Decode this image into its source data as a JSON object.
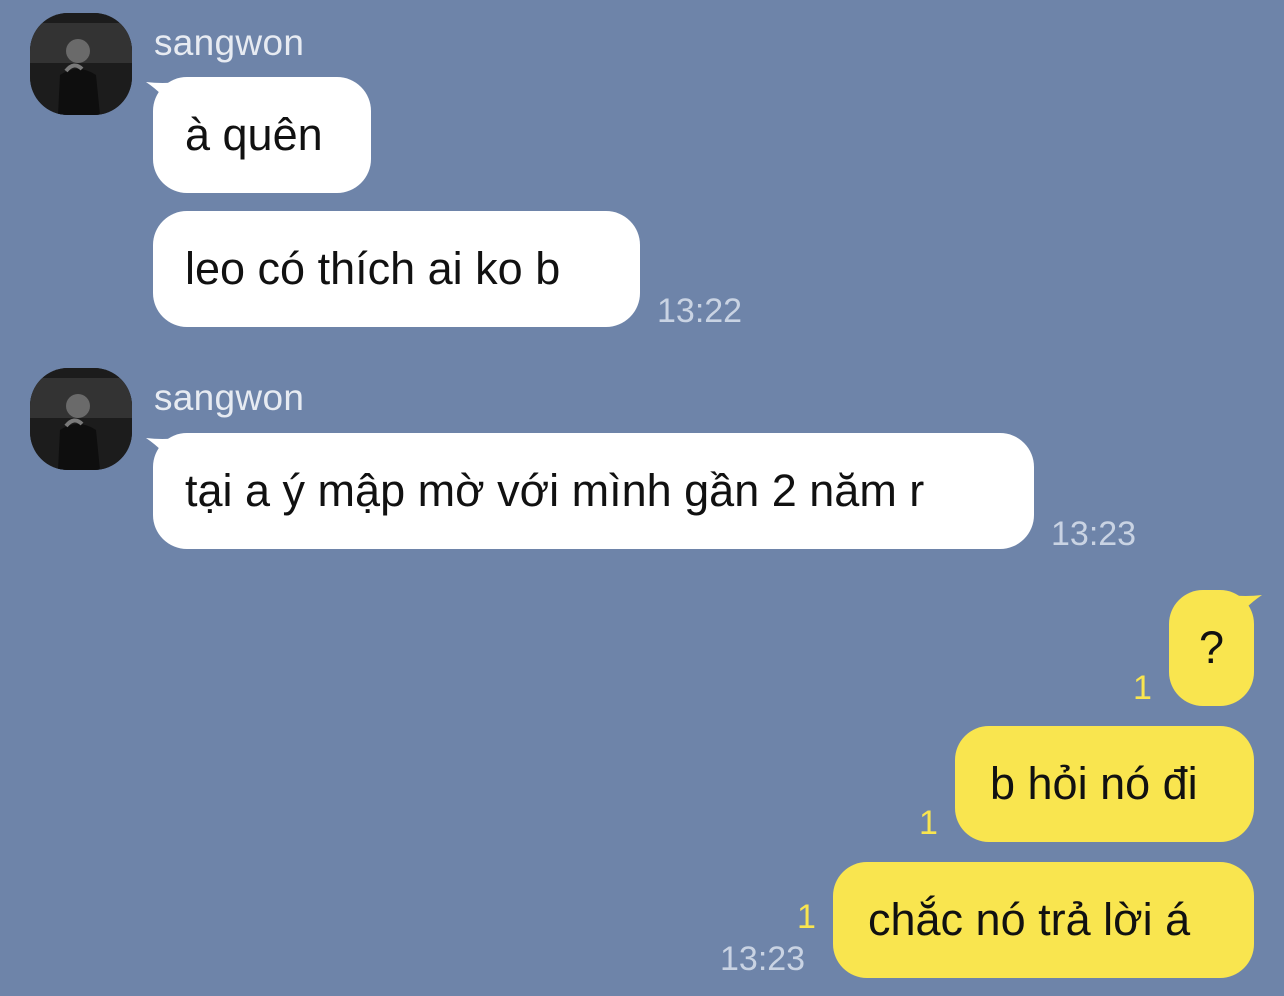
{
  "chat": {
    "groups": [
      {
        "sender": "sangwon",
        "messages": [
          "à quên",
          "leo có thích ai ko b"
        ],
        "time": "13:22"
      },
      {
        "sender": "sangwon",
        "messages": [
          "tại a ý mập mờ với mình gần 2 năm r"
        ],
        "time": "13:23"
      }
    ],
    "outgoing": [
      {
        "text": "?",
        "unread": "1"
      },
      {
        "text": "b hỏi nó đi",
        "unread": "1"
      },
      {
        "text": "chắc nó trả lời á",
        "unread": "1"
      }
    ],
    "outgoing_time": "13:23"
  },
  "colors": {
    "background": "#6e84a9",
    "incoming_bubble": "#ffffff",
    "outgoing_bubble": "#f9e54f",
    "unread_count": "#f9e54f",
    "timestamp": "#c9d3e3"
  }
}
